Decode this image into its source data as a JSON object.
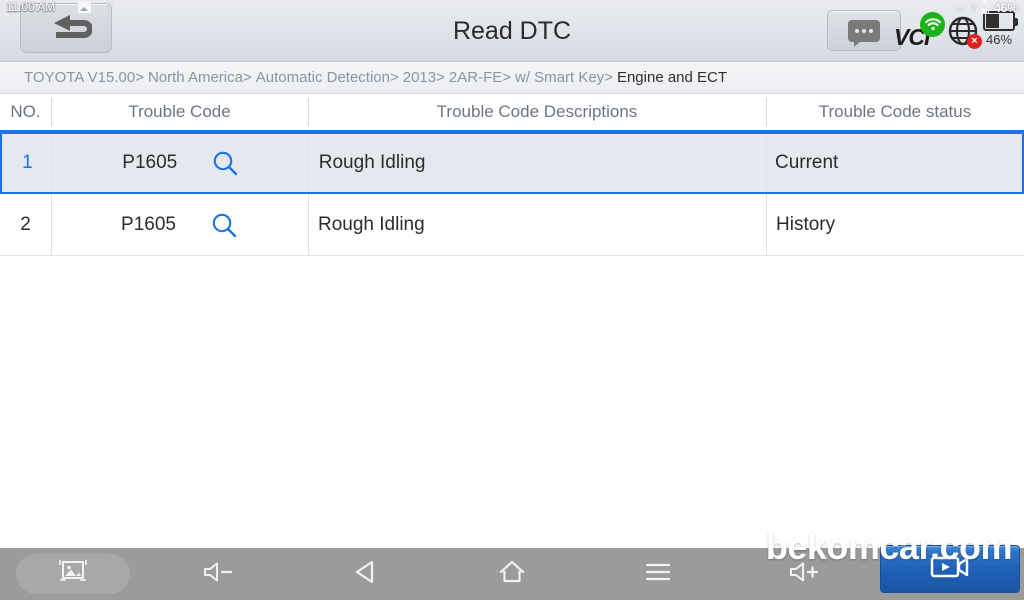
{
  "status_bar": {
    "time": "11:00 AM",
    "image_icon": "image-icon",
    "upload_icon": "upload-arrow-icon",
    "battery_percent_small": "46%"
  },
  "header": {
    "back_label": "back-arrow-icon",
    "title": "Read DTC",
    "chat_icon": "chat-bubble-icon",
    "vci_label": "VCI",
    "wifi_icon": "wifi-icon",
    "globe_icon": "globe-icon",
    "globe_error_mark": "×",
    "battery_percent": "46%"
  },
  "breadcrumb": {
    "separator": ">",
    "items": [
      {
        "label": "TOYOTA V15.00",
        "current": false
      },
      {
        "label": "North America",
        "current": false
      },
      {
        "label": "Automatic Detection",
        "current": false
      },
      {
        "label": "2013",
        "current": false
      },
      {
        "label": "2AR-FE",
        "current": false
      },
      {
        "label": "w/ Smart Key",
        "current": false
      },
      {
        "label": "Engine and ECT",
        "current": true
      }
    ]
  },
  "table": {
    "columns": [
      {
        "key": "no",
        "label": "NO."
      },
      {
        "key": "code",
        "label": "Trouble Code"
      },
      {
        "key": "desc",
        "label": "Trouble Code Descriptions"
      },
      {
        "key": "status",
        "label": "Trouble Code status"
      }
    ],
    "rows": [
      {
        "no": "1",
        "code": "P1605",
        "search_icon": "search-icon",
        "desc": "Rough Idling",
        "status": "Current",
        "selected": true
      },
      {
        "no": "2",
        "code": "P1605",
        "search_icon": "search-icon",
        "desc": "Rough Idling",
        "status": "History",
        "selected": false
      }
    ]
  },
  "navbar": {
    "items": [
      {
        "name": "screenshot-button",
        "icon": "screenshot-icon",
        "highlighted": true
      },
      {
        "name": "volume-down-button",
        "icon": "volume-down-icon",
        "highlighted": false
      },
      {
        "name": "back-button",
        "icon": "back-triangle-icon",
        "highlighted": false
      },
      {
        "name": "home-button",
        "icon": "home-icon",
        "highlighted": false
      },
      {
        "name": "menu-button",
        "icon": "hamburger-menu-icon",
        "highlighted": false
      },
      {
        "name": "volume-up-button",
        "icon": "volume-up-icon",
        "highlighted": false
      },
      {
        "name": "vehicle-button",
        "icon": "car-icon",
        "highlighted": false
      }
    ],
    "video_button": {
      "name": "video-record-button",
      "icon": "video-camera-icon"
    }
  },
  "watermark": {
    "text": "bekomcar.com"
  },
  "colors": {
    "accent": "#1a73e8",
    "selected_row_bg": "#e4e9f0",
    "header_bg": "#e2e5eb",
    "navbar_bg": "#9b9b9b",
    "breadcrumb_text": "#8a94a6",
    "battery_green": "#18b418",
    "globe_error_red": "#e02020"
  }
}
